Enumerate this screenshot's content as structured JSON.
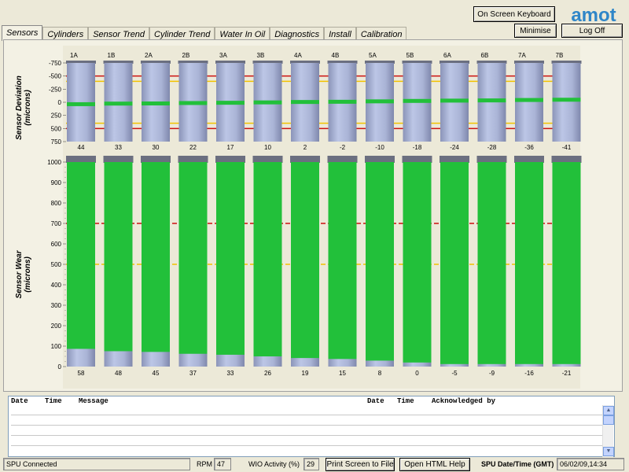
{
  "toolbar": {
    "keyboard_label": "On Screen Keyboard",
    "minimise_label": "Minimise",
    "logoff_label": "Log Off",
    "logo_text": "amot"
  },
  "tabs": [
    {
      "label": "Sensors",
      "active": true
    },
    {
      "label": "Cylinders",
      "active": false
    },
    {
      "label": "Sensor Trend",
      "active": false
    },
    {
      "label": "Cylinder Trend",
      "active": false
    },
    {
      "label": "Water In Oil",
      "active": false
    },
    {
      "label": "Diagnostics",
      "active": false
    },
    {
      "label": "Install",
      "active": false
    },
    {
      "label": "Calibration",
      "active": false
    }
  ],
  "colors": {
    "red_limit": "#cc1111",
    "yellow_limit": "#f2c200",
    "bar_fill": "#aab4d6",
    "green_indicator": "#22c03a"
  },
  "chart_data": [
    {
      "type": "bar",
      "ylabel": "Sensor Deviation\n(microns)",
      "categories": [
        "1A",
        "1B",
        "2A",
        "2B",
        "3A",
        "3B",
        "4A",
        "4B",
        "5A",
        "5B",
        "6A",
        "6B",
        "7A",
        "7B"
      ],
      "values": [
        44,
        33,
        30,
        22,
        17,
        10,
        2,
        -2,
        -10,
        -18,
        -24,
        -28,
        -36,
        -41
      ],
      "value_labels": [
        "44",
        "33",
        "30",
        "22",
        "17",
        "10",
        "2",
        "-2",
        "-10",
        "-18",
        "-24",
        "-28",
        "-36",
        "-41"
      ],
      "ylim": [
        -750,
        750
      ],
      "ticks": [
        "750",
        "500",
        "250",
        "0",
        "-250",
        "-500",
        "-750"
      ],
      "tick_values": [
        750,
        500,
        250,
        0,
        -250,
        -500,
        -750
      ],
      "limits": {
        "red": [
          500,
          -500
        ],
        "yellow": [
          400,
          -400
        ]
      }
    },
    {
      "type": "bar",
      "ylabel": "Sensor Wear\n(microns)",
      "categories": [
        "1A",
        "1B",
        "2A",
        "2B",
        "3A",
        "3B",
        "4A",
        "4B",
        "5A",
        "5B",
        "6A",
        "6B",
        "7A",
        "7B"
      ],
      "values": [
        58,
        48,
        45,
        37,
        33,
        26,
        19,
        15,
        8,
        0,
        -5,
        -9,
        -16,
        -21
      ],
      "value_labels": [
        "58",
        "48",
        "45",
        "37",
        "33",
        "26",
        "19",
        "15",
        "8",
        "0",
        "-5",
        "-9",
        "-16",
        "-21"
      ],
      "ylim": [
        1000,
        0
      ],
      "ticks": [
        "0",
        "100",
        "200",
        "300",
        "400",
        "500",
        "600",
        "700",
        "800",
        "900",
        "1000"
      ],
      "tick_values": [
        0,
        100,
        200,
        300,
        400,
        500,
        600,
        700,
        800,
        900,
        1000
      ],
      "limits": {
        "red": [
          700
        ],
        "yellow": [
          500
        ]
      }
    }
  ],
  "messages": {
    "left_headers": [
      "Date",
      "Time",
      "Message"
    ],
    "right_headers": [
      "Date",
      "Time",
      "Acknowledged by"
    ]
  },
  "status": {
    "connection": "SPU Connected",
    "rpm_label": "RPM",
    "rpm_value": "47",
    "wio_label": "WIO Activity (%)",
    "wio_value": "29",
    "print_label": "Print Screen to File",
    "help_label": "Open HTML Help",
    "datetime_label": "SPU Date/Time (GMT)",
    "datetime_value": "06/02/09,14:34"
  }
}
